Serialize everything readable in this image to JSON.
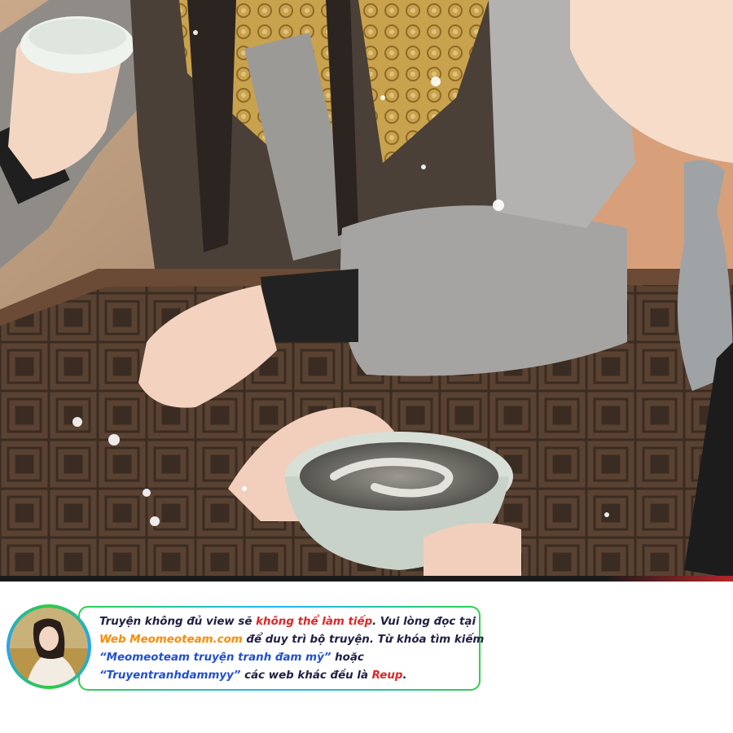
{
  "notice": {
    "line1_a": "Truyện không đủ view sẽ ",
    "line1_b": "không thể làm tiếp",
    "line1_c": ". Vui lòng đọc tại",
    "line2_a": "Web Meomeoteam.com",
    "line2_b": " để duy trì bộ truyện. Từ khóa tìm kiếm",
    "line3_a": "“Meomeoteam truyện tranh đam mỹ”",
    "line3_b": " hoặc",
    "line4_a": "“Truyentranhdammyy”",
    "line4_b": " các web khác đều là ",
    "line4_c": "Reup",
    "line4_d": "."
  },
  "colors": {
    "warning_red": "#e02424",
    "site_orange": "#ff8a00",
    "keyword_blue": "#1f4fd6",
    "border_green": "#2fd14a",
    "border_blue": "#1fb6ff"
  }
}
